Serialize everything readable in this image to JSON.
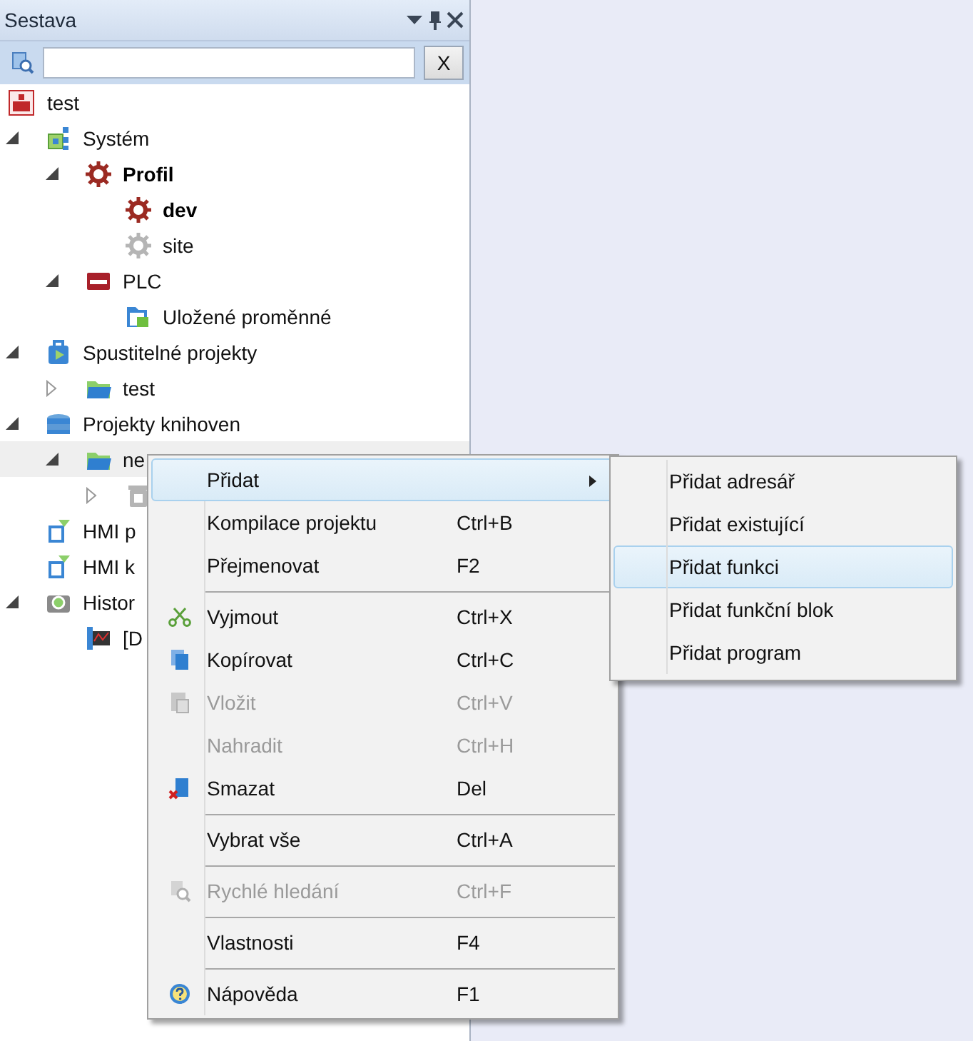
{
  "panel": {
    "title": "Sestava",
    "search": {
      "clear_label": "X"
    }
  },
  "tree": {
    "root": {
      "label": "test"
    },
    "nodes": [
      {
        "label": "Systém",
        "expanded": true,
        "bold": false,
        "selected": false,
        "dim_icon": false,
        "children": [
          {
            "label": "Profil",
            "expanded": true,
            "bold": true,
            "selected": false,
            "dim_icon": false,
            "children": [
              {
                "label": "dev",
                "bold": true,
                "selected": false,
                "dim_icon": false
              },
              {
                "label": "site",
                "bold": false,
                "selected": false,
                "dim_icon": true
              }
            ]
          },
          {
            "label": "PLC",
            "expanded": true,
            "bold": false,
            "selected": false,
            "dim_icon": false,
            "children": [
              {
                "label": "Uložené proměnné",
                "bold": false,
                "selected": false,
                "dim_icon": false
              }
            ]
          }
        ]
      },
      {
        "label": "Spustitelné projekty",
        "expanded": true,
        "bold": false,
        "selected": false,
        "dim_icon": false,
        "children": [
          {
            "label": "test",
            "expanded": false,
            "bold": false,
            "selected": false,
            "dim_icon": false
          }
        ]
      },
      {
        "label": "Projekty knihoven",
        "expanded": true,
        "bold": false,
        "selected": false,
        "dim_icon": false,
        "children": [
          {
            "label": "ne",
            "expanded": true,
            "bold": false,
            "selected": true,
            "dim_icon": false,
            "children": [
              {
                "expanded": false,
                "selected": false,
                "dim_icon": true
              }
            ]
          }
        ]
      },
      {
        "label": "HMI p",
        "bold": false,
        "selected": false,
        "dim_icon": false
      },
      {
        "label": "HMI k",
        "bold": false,
        "selected": false,
        "dim_icon": false
      },
      {
        "label": "Histor",
        "expanded": true,
        "bold": false,
        "selected": false,
        "dim_icon": false,
        "children": [
          {
            "label": "[D",
            "bold": false,
            "selected": false,
            "dim_icon": false
          }
        ]
      }
    ]
  },
  "context_menu": {
    "items": [
      {
        "kind": "item",
        "label": "Přidat",
        "selected": true,
        "disabled": false,
        "submenu": true
      },
      {
        "kind": "item",
        "label": "Kompilace projektu",
        "shortcut": "Ctrl+B",
        "selected": false,
        "disabled": false,
        "submenu": false
      },
      {
        "kind": "item",
        "label": "Přejmenovat",
        "shortcut": "F2",
        "selected": false,
        "disabled": false,
        "submenu": false
      },
      {
        "kind": "separator"
      },
      {
        "kind": "item",
        "label": "Vyjmout",
        "shortcut": "Ctrl+X",
        "selected": false,
        "disabled": false,
        "submenu": false
      },
      {
        "kind": "item",
        "label": "Kopírovat",
        "shortcut": "Ctrl+C",
        "selected": false,
        "disabled": false,
        "submenu": false
      },
      {
        "kind": "item",
        "label": "Vložit",
        "shortcut": "Ctrl+V",
        "selected": false,
        "disabled": true,
        "submenu": false
      },
      {
        "kind": "item",
        "label": "Nahradit",
        "shortcut": "Ctrl+H",
        "selected": false,
        "disabled": true,
        "submenu": false
      },
      {
        "kind": "item",
        "label": "Smazat",
        "shortcut": "Del",
        "selected": false,
        "disabled": false,
        "submenu": false
      },
      {
        "kind": "separator"
      },
      {
        "kind": "item",
        "label": "Vybrat vše",
        "shortcut": "Ctrl+A",
        "selected": false,
        "disabled": false,
        "submenu": false
      },
      {
        "kind": "separator"
      },
      {
        "kind": "item",
        "label": "Rychlé hledání",
        "shortcut": "Ctrl+F",
        "selected": false,
        "disabled": true,
        "submenu": false
      },
      {
        "kind": "separator"
      },
      {
        "kind": "item",
        "label": "Vlastnosti",
        "shortcut": "F4",
        "selected": false,
        "disabled": false,
        "submenu": false
      },
      {
        "kind": "separator"
      },
      {
        "kind": "item",
        "label": "Nápověda",
        "shortcut": "F1",
        "selected": false,
        "disabled": false,
        "submenu": false
      }
    ]
  },
  "submenu": {
    "items": [
      {
        "label": "Přidat adresář",
        "selected": false
      },
      {
        "label": "Přidat existující",
        "selected": false
      },
      {
        "label": "Přidat funkci",
        "selected": true
      },
      {
        "label": "Přidat funkční blok",
        "selected": false
      },
      {
        "label": "Přidat program",
        "selected": false
      }
    ]
  }
}
